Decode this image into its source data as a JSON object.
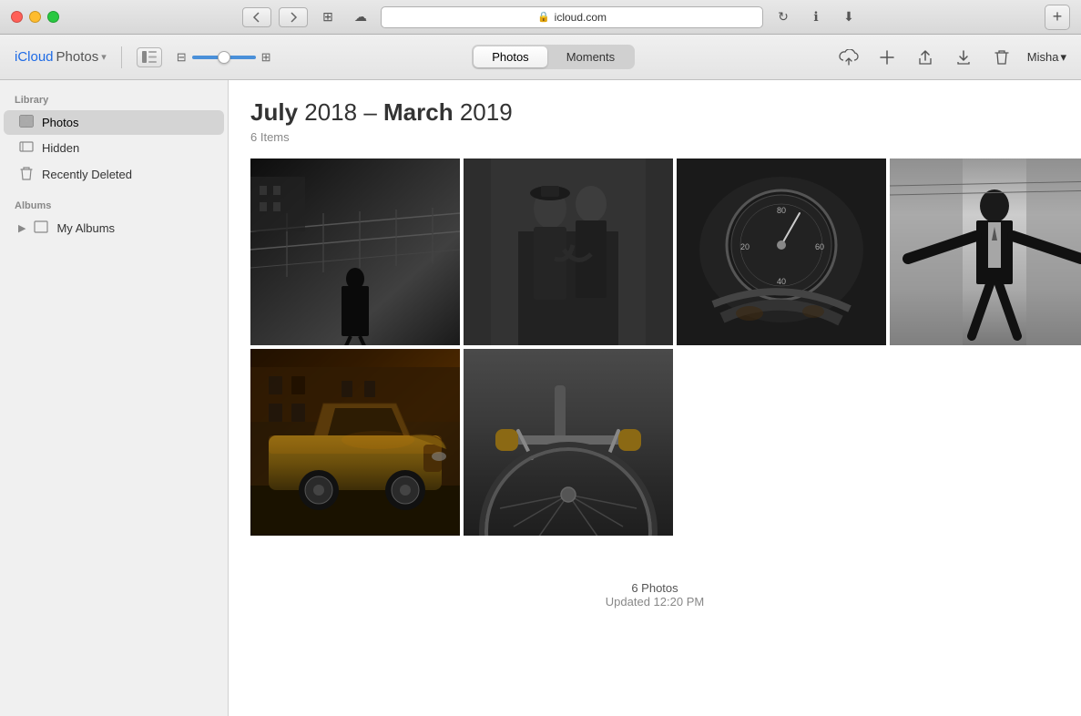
{
  "titlebar": {
    "url": "icloud.com",
    "lock_label": "🔒",
    "plus_label": "+"
  },
  "toolbar": {
    "app_title_icloud": "iCloud",
    "app_title_photos": " Photos",
    "app_title_arrow": "▾",
    "sidebar_toggle_icon": "⊞",
    "seg_photos": "Photos",
    "seg_moments": "Moments",
    "upload_icon": "↑",
    "add_icon": "+",
    "share_icon": "↑",
    "download_icon": "↓",
    "delete_icon": "🗑",
    "user_label": "Misha",
    "user_arrow": "▾"
  },
  "sidebar": {
    "library_label": "Library",
    "items": [
      {
        "id": "photos",
        "label": "Photos",
        "icon": "▦",
        "active": true
      },
      {
        "id": "hidden",
        "label": "Hidden",
        "icon": "▭"
      },
      {
        "id": "recently-deleted",
        "label": "Recently Deleted",
        "icon": "🗑"
      }
    ],
    "albums_label": "Albums",
    "my_albums_label": "My Albums",
    "my_albums_icon": "▦",
    "my_albums_arrow": "▶"
  },
  "content": {
    "date_start_bold": "July",
    "date_start_light": " 2018 – ",
    "date_end_bold": "March",
    "date_end_light": " 2019",
    "items_count": "6 Items",
    "photos_count": "6 Photos",
    "updated": "Updated 12:20 PM"
  },
  "photos": [
    {
      "id": "photo-1",
      "alt": "Person walking on stairs black and white",
      "type": "bw_stairs"
    },
    {
      "id": "photo-2",
      "alt": "Couple portrait black and white",
      "type": "bw_couple"
    },
    {
      "id": "photo-3",
      "alt": "Motorcycle gauge close up black and white",
      "type": "bw_moto"
    },
    {
      "id": "photo-4",
      "alt": "Man with arms spread black and white",
      "type": "bw_arms"
    },
    {
      "id": "photo-5",
      "alt": "Vintage Porsche car color",
      "type": "color_car"
    },
    {
      "id": "photo-6",
      "alt": "Bicycle close up black and white",
      "type": "bw_bike"
    }
  ]
}
